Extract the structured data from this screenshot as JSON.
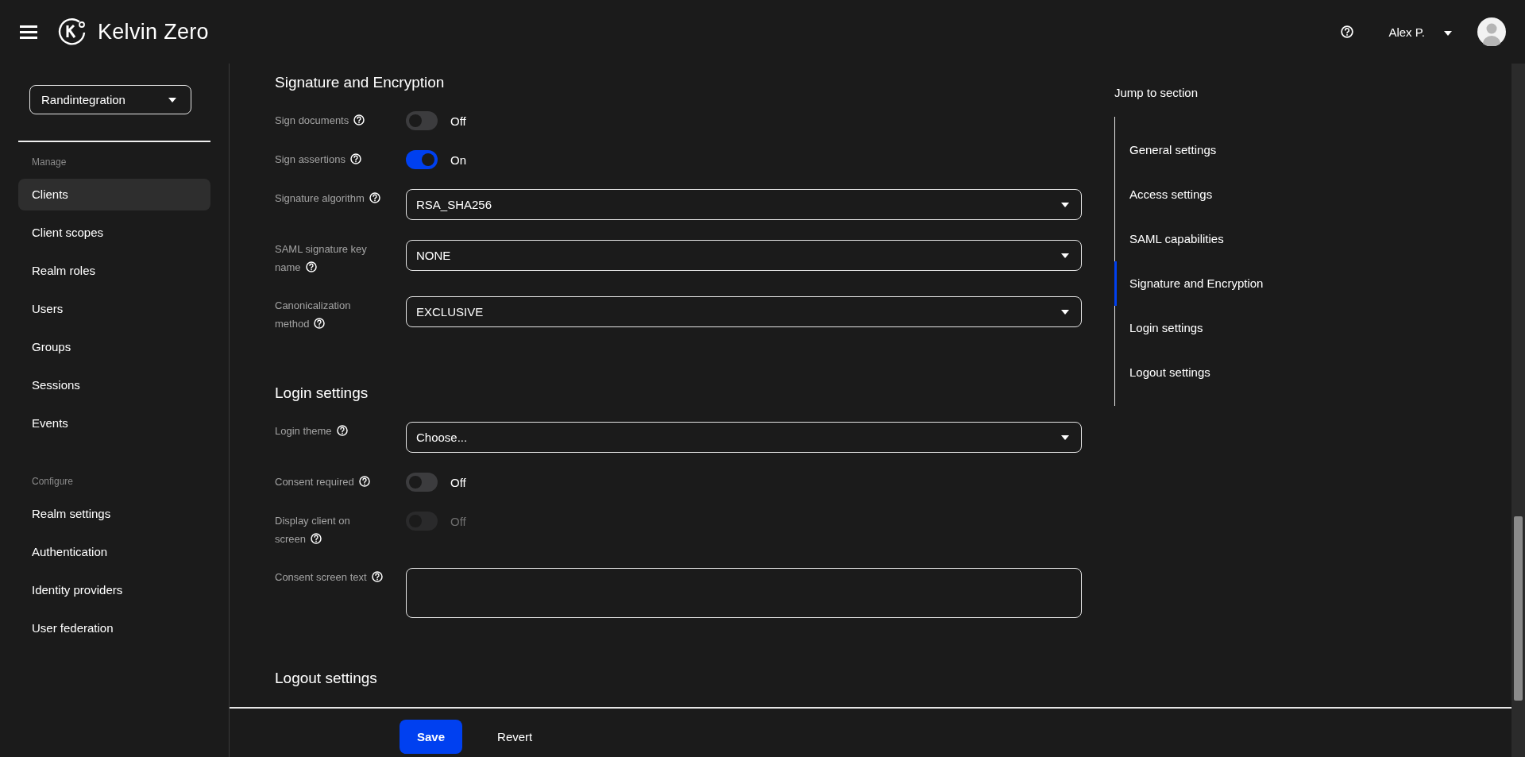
{
  "header": {
    "brand": "Kelvin Zero",
    "user": "Alex P."
  },
  "sidebar": {
    "realm": "Randintegration",
    "groups": [
      {
        "title": "Manage",
        "items": [
          {
            "label": "Clients",
            "selected": true
          },
          {
            "label": "Client scopes",
            "selected": false
          },
          {
            "label": "Realm roles",
            "selected": false
          },
          {
            "label": "Users",
            "selected": false
          },
          {
            "label": "Groups",
            "selected": false
          },
          {
            "label": "Sessions",
            "selected": false
          },
          {
            "label": "Events",
            "selected": false
          }
        ]
      },
      {
        "title": "Configure",
        "items": [
          {
            "label": "Realm settings",
            "selected": false
          },
          {
            "label": "Authentication",
            "selected": false
          },
          {
            "label": "Identity providers",
            "selected": false
          },
          {
            "label": "User federation",
            "selected": false
          }
        ]
      }
    ]
  },
  "sections": [
    {
      "title": "Signature and Encryption",
      "fields": [
        {
          "kind": "switch",
          "label": "Sign documents",
          "on": false,
          "disabled": false,
          "state_text": "Off"
        },
        {
          "kind": "switch",
          "label": "Sign assertions",
          "on": true,
          "disabled": false,
          "state_text": "On"
        },
        {
          "kind": "select",
          "label": "Signature algorithm",
          "value": "RSA_SHA256"
        },
        {
          "kind": "select",
          "label": "SAML signature key name",
          "value": "NONE"
        },
        {
          "kind": "select",
          "label": "Canonicalization method",
          "value": "EXCLUSIVE"
        }
      ]
    },
    {
      "title": "Login settings",
      "fields": [
        {
          "kind": "select",
          "label": "Login theme",
          "value": "Choose..."
        },
        {
          "kind": "switch",
          "label": "Consent required",
          "on": false,
          "disabled": false,
          "state_text": "Off"
        },
        {
          "kind": "switch",
          "label": "Display client on screen",
          "on": false,
          "disabled": true,
          "state_text": "Off"
        },
        {
          "kind": "textarea",
          "label": "Consent screen text"
        }
      ]
    },
    {
      "title": "Logout settings"
    }
  ],
  "jump": {
    "title": "Jump to section",
    "items": [
      {
        "label": "General settings",
        "selected": false
      },
      {
        "label": "Access settings",
        "selected": false
      },
      {
        "label": "SAML capabilities",
        "selected": false
      },
      {
        "label": "Signature and Encryption",
        "selected": true
      },
      {
        "label": "Login settings",
        "selected": false
      },
      {
        "label": "Logout settings",
        "selected": false
      }
    ]
  },
  "footer": {
    "buttons": [
      {
        "label": "Save",
        "kind": "primary"
      },
      {
        "label": "Revert",
        "kind": "link"
      }
    ]
  }
}
